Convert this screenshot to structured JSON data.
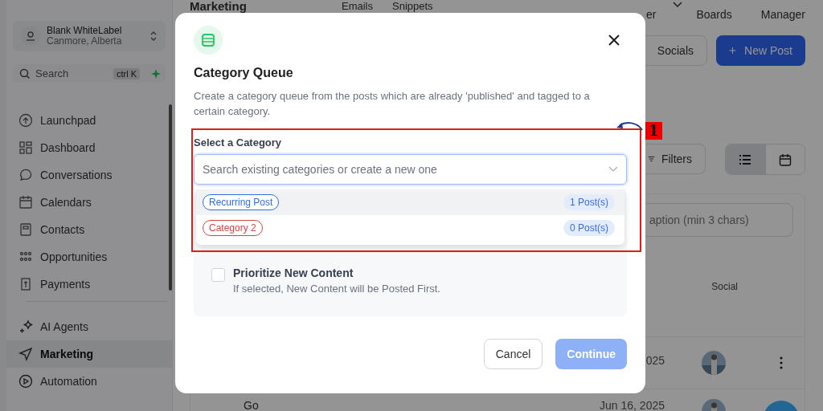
{
  "sidebar": {
    "account": {
      "name": "Blank WhiteLabel",
      "location": "Canmore, Alberta"
    },
    "search": {
      "placeholder": "Search",
      "shortcut": "ctrl K"
    },
    "items": [
      {
        "label": "Launchpad",
        "selected": false
      },
      {
        "label": "Dashboard",
        "selected": false
      },
      {
        "label": "Conversations",
        "selected": false
      },
      {
        "label": "Calendars",
        "selected": false
      },
      {
        "label": "Contacts",
        "selected": false
      },
      {
        "label": "Opportunities",
        "selected": false
      },
      {
        "label": "Payments",
        "selected": false
      }
    ],
    "items_2": [
      {
        "label": "AI Agents",
        "selected": false
      },
      {
        "label": "Marketing",
        "selected": true
      },
      {
        "label": "Automation",
        "selected": false
      }
    ]
  },
  "header": {
    "title": "Marketing",
    "tabs_left": [
      "Emails",
      "Snippets"
    ],
    "tabs_right": [
      "er",
      "Boards",
      "Manager"
    ]
  },
  "actions": {
    "socials": "Socials",
    "new_post": "New Post",
    "filters": "Filters"
  },
  "view_toggle": [
    {
      "selected": true
    },
    {
      "selected": false
    }
  ],
  "table": {
    "search_placeholder": "aption (min 3 chars)",
    "column_social": "Social",
    "rows": [
      {
        "date": "025"
      },
      {
        "title": "Go",
        "date": "Jun 16, 2025"
      }
    ]
  },
  "dialog": {
    "title": "Category Queue",
    "description": "Create a category queue from the posts which are already 'published' and tagged to a certain category.",
    "field_label": "Select a Category",
    "placeholder": "Search existing categories or create a new one",
    "options": [
      {
        "name": "Recurring Post",
        "count": "1 Post(s)",
        "color": "#2f6fe4",
        "selected": true
      },
      {
        "name": "Category 2",
        "count": "0 Post(s)",
        "color": "#d64545",
        "selected": false
      }
    ],
    "prioritize": {
      "label": "Prioritize New Content",
      "hint": "If selected, New Content will be Posted First.",
      "checked": false
    },
    "cancel": "Cancel",
    "continue": {
      "label": "Continue",
      "disabled": true
    }
  },
  "annotation": {
    "number": "1"
  }
}
